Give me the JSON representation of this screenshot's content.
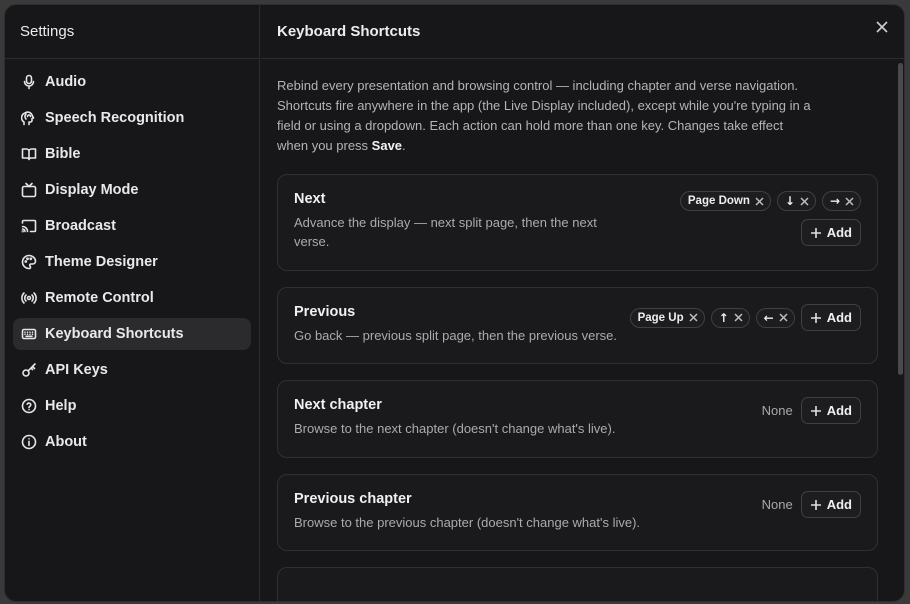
{
  "sidebar": {
    "title": "Settings",
    "items": [
      {
        "label": "Audio",
        "icon": "microphone-icon"
      },
      {
        "label": "Speech Recognition",
        "icon": "speech-icon"
      },
      {
        "label": "Bible",
        "icon": "book-icon"
      },
      {
        "label": "Display Mode",
        "icon": "tv-icon"
      },
      {
        "label": "Broadcast",
        "icon": "cast-icon"
      },
      {
        "label": "Theme Designer",
        "icon": "palette-icon"
      },
      {
        "label": "Remote Control",
        "icon": "radio-icon"
      },
      {
        "label": "Keyboard Shortcuts",
        "icon": "keyboard-icon",
        "active": true
      },
      {
        "label": "API Keys",
        "icon": "key-icon"
      },
      {
        "label": "Help",
        "icon": "help-circle-icon"
      },
      {
        "label": "About",
        "icon": "info-icon"
      }
    ]
  },
  "main": {
    "title": "Keyboard Shortcuts",
    "intro_text": "Rebind every presentation and browsing control — including chapter and verse navigation. Shortcuts fire anywhere in the app (the Live Display included), except while you're typing in a field or using a dropdown. Each action can hold more than one key. Changes take effect when you press ",
    "intro_save": "Save",
    "intro_end": "."
  },
  "shortcuts": [
    {
      "title": "Next",
      "description": "Advance the display — next split page, then the next verse.",
      "keys": [
        "Page Down",
        "↓",
        "→"
      ],
      "add_label": "Add"
    },
    {
      "title": "Previous",
      "description": "Go back — previous split page, then the previous verse.",
      "keys": [
        "Page Up",
        "↑",
        "←"
      ],
      "add_label": "Add"
    },
    {
      "title": "Next chapter",
      "description": "Browse to the next chapter (doesn't change what's live).",
      "none_label": "None",
      "add_label": "Add"
    },
    {
      "title": "Previous chapter",
      "description": "Browse to the previous chapter (doesn't change what's live).",
      "none_label": "None",
      "add_label": "Add"
    }
  ],
  "colors": {
    "background": "#171719",
    "active_item": "#2b2b2e",
    "border": "#303034"
  }
}
